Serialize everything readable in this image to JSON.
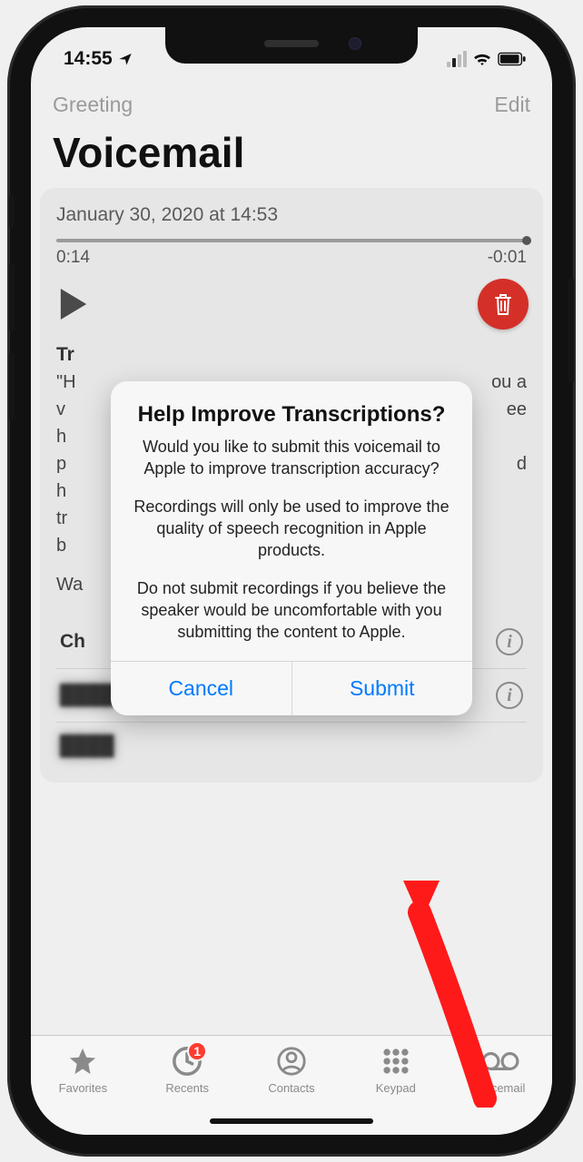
{
  "status": {
    "time": "14:55",
    "has_location": true
  },
  "nav": {
    "left": "Greeting",
    "right": "Edit",
    "title": "Voicemail"
  },
  "voicemail": {
    "date_line": "January 30, 2020 at 14:53",
    "time_elapsed": "0:14",
    "time_remaining": "-0:01",
    "transcript_title": "Tr",
    "transcript_lines": [
      {
        "left": "\"H",
        "right": "ou a"
      },
      {
        "left": "v",
        "right": "ee"
      },
      {
        "left": "h",
        "right": ""
      },
      {
        "left": "p",
        "right": "d"
      },
      {
        "left": "h",
        "right": ""
      },
      {
        "left": "tr",
        "right": ""
      },
      {
        "left": "b",
        "right": ""
      }
    ],
    "was_line_left": "Wa",
    "was_line_right": "?",
    "caller_label": "Ch"
  },
  "modal": {
    "title": "Help Improve Transcriptions?",
    "p1": "Would you like to submit this voicemail to Apple to improve transcription accuracy?",
    "p2": "Recordings will only be used to improve the quality of speech recognition in Apple products.",
    "p3": "Do not submit recordings if you believe the speaker would be uncomfortable with you submitting the content to Apple.",
    "cancel": "Cancel",
    "submit": "Submit"
  },
  "tabs": {
    "favorites": "Favorites",
    "recents": "Recents",
    "recents_badge": "1",
    "contacts": "Contacts",
    "keypad": "Keypad",
    "voicemail": "Voicemail"
  },
  "colors": {
    "accent": "#007aff",
    "destructive": "#d43028",
    "badge": "#ff3b30"
  }
}
